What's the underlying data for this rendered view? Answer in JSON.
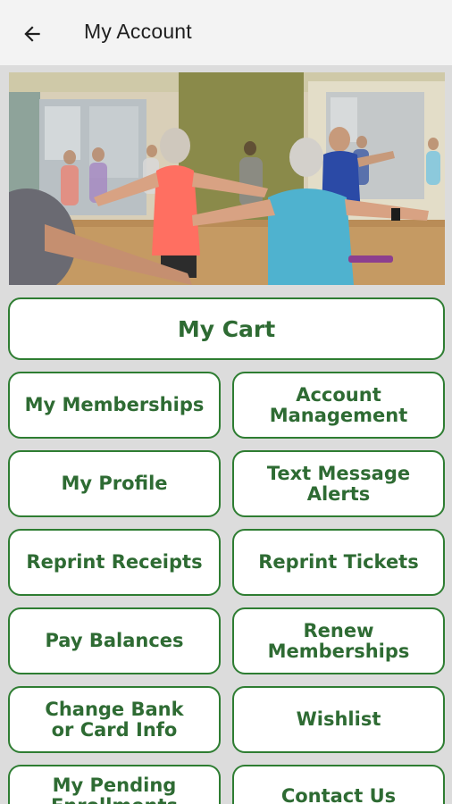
{
  "appbar": {
    "title": "My Account",
    "back_icon": "arrow-left-icon"
  },
  "hero": {
    "image": "group-exercise-class-photo"
  },
  "colors": {
    "accent_green": "#2e7d32",
    "text_green": "#2e6b33",
    "background": "#dcdcdc",
    "appbar_bg": "#f3f3f3"
  },
  "buttons": {
    "my_cart": "My Cart",
    "my_memberships": "My Memberships",
    "account_management": "Account\nManagement",
    "my_profile": "My Profile",
    "text_message_alerts": "Text Message\nAlerts",
    "reprint_receipts": "Reprint Receipts",
    "reprint_tickets": "Reprint Tickets",
    "pay_balances": "Pay Balances",
    "renew_memberships": "Renew\nMemberships",
    "change_bank_card": "Change Bank\nor Card Info",
    "wishlist": "Wishlist",
    "my_pending": "My Pending\nEnrollments",
    "contact_us": "Contact Us"
  }
}
